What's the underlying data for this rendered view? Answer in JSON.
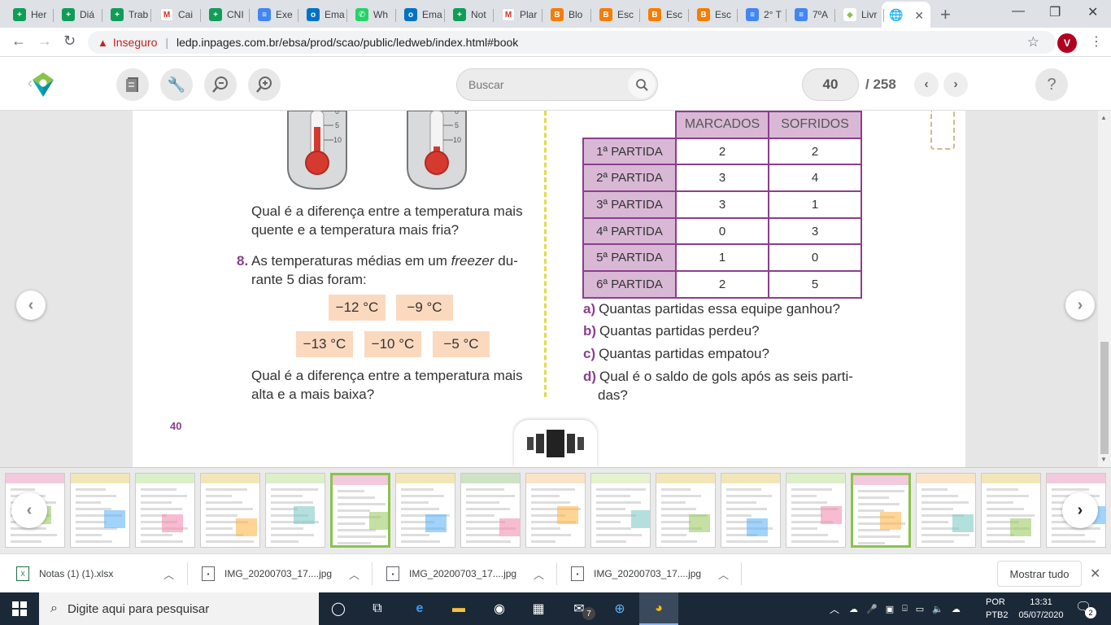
{
  "browser": {
    "tabs": [
      {
        "label": "Her",
        "color": "#0f9d58",
        "glyph": "+"
      },
      {
        "label": "Diá",
        "color": "#0f9d58",
        "glyph": "+"
      },
      {
        "label": "Trab",
        "color": "#0f9d58",
        "glyph": "+"
      },
      {
        "label": "Cai",
        "color": "#ffffff",
        "glyph": "M"
      },
      {
        "label": "CNI",
        "color": "#0f9d58",
        "glyph": "+"
      },
      {
        "label": "Exe",
        "color": "#4285f4",
        "glyph": "≡"
      },
      {
        "label": "Ema",
        "color": "#0072c6",
        "glyph": "o"
      },
      {
        "label": "Wh",
        "color": "#25d366",
        "glyph": "✆"
      },
      {
        "label": "Ema",
        "color": "#0072c6",
        "glyph": "o"
      },
      {
        "label": "Not",
        "color": "#0f9d58",
        "glyph": "+"
      },
      {
        "label": "Plar",
        "color": "#ffffff",
        "glyph": "M"
      },
      {
        "label": "Blo",
        "color": "#f57d00",
        "glyph": "B"
      },
      {
        "label": "Esc",
        "color": "#f57d00",
        "glyph": "B"
      },
      {
        "label": "Esc",
        "color": "#f57d00",
        "glyph": "B"
      },
      {
        "label": "Esc",
        "color": "#f57d00",
        "glyph": "B"
      },
      {
        "label": "2° T",
        "color": "#4285f4",
        "glyph": "≡"
      },
      {
        "label": "7ºA",
        "color": "#4285f4",
        "glyph": "≡"
      },
      {
        "label": "Livr",
        "color": "#ffffff",
        "glyph": "◆"
      }
    ],
    "active_tab_icon": "globe-icon",
    "security_label": "Inseguro",
    "url": "ledp.inpages.com.br/ebsa/prod/scao/public/ledweb/index.html#book",
    "avatar_letter": "V"
  },
  "reader": {
    "search_placeholder": "Buscar",
    "current_page": "40",
    "total_pages": "/ 258",
    "help_label": "?"
  },
  "book": {
    "q7_text_line1": "Qual é a diferença entre a temperatura mais",
    "q7_text_line2": "quente e a temperatura mais fria?",
    "q8_number": "8.",
    "q8_line1_a": "As temperaturas médias em um ",
    "q8_line1_em": "freezer",
    "q8_line1_b": " du-",
    "q8_line2": "rante 5 dias foram:",
    "temps_row1": [
      "−12 °C",
      "−9 °C"
    ],
    "temps_row2": [
      "−13 °C",
      "−10 °C",
      "−5 °C"
    ],
    "q8_ask_line1": "Qual é a diferença entre a temperatura mais",
    "q8_ask_line2": "alta e a mais baixa?",
    "page_number": "40",
    "table": {
      "headers": [
        "MARCADOS",
        "SOFRIDOS"
      ],
      "rows": [
        {
          "label": "1ª PARTIDA",
          "marcados": "2",
          "sofridos": "2"
        },
        {
          "label": "2ª PARTIDA",
          "marcados": "3",
          "sofridos": "4"
        },
        {
          "label": "3ª PARTIDA",
          "marcados": "3",
          "sofridos": "1"
        },
        {
          "label": "4ª PARTIDA",
          "marcados": "0",
          "sofridos": "3"
        },
        {
          "label": "5ª PARTIDA",
          "marcados": "1",
          "sofridos": "0"
        },
        {
          "label": "6ª PARTIDA",
          "marcados": "2",
          "sofridos": "5"
        }
      ]
    },
    "subquestions": [
      {
        "letter": "a)",
        "text": "Quantas partidas essa equipe ganhou?"
      },
      {
        "letter": "b)",
        "text": "Quantas partidas perdeu?"
      },
      {
        "letter": "c)",
        "text": "Quantas partidas empatou?"
      },
      {
        "letter": "d)",
        "text": "Qual é o saldo de gols após as seis parti-"
      }
    ],
    "subq_d_line2": "das?",
    "thermo_ticks": [
      "0",
      "5",
      "10"
    ]
  },
  "downloads": {
    "items": [
      {
        "name": "Notas (1) (1).xlsx",
        "type": "excel"
      },
      {
        "name": "IMG_20200703_17....jpg",
        "type": "image"
      },
      {
        "name": "IMG_20200703_17....jpg",
        "type": "image"
      },
      {
        "name": "IMG_20200703_17....jpg",
        "type": "image"
      }
    ],
    "show_all": "Mostrar tudo"
  },
  "taskbar": {
    "search_placeholder": "Digite aqui para pesquisar",
    "mail_badge": "7",
    "lang_top": "POR",
    "lang_bottom": "PTB2",
    "time": "13:31",
    "date": "05/07/2020",
    "notif_count": "2"
  },
  "colors": {
    "accent_purple": "#8a3f8e",
    "table_header": "#d9b8d6",
    "temp_box": "#fbd9bf",
    "selected_thumb": "#8bc34a"
  }
}
